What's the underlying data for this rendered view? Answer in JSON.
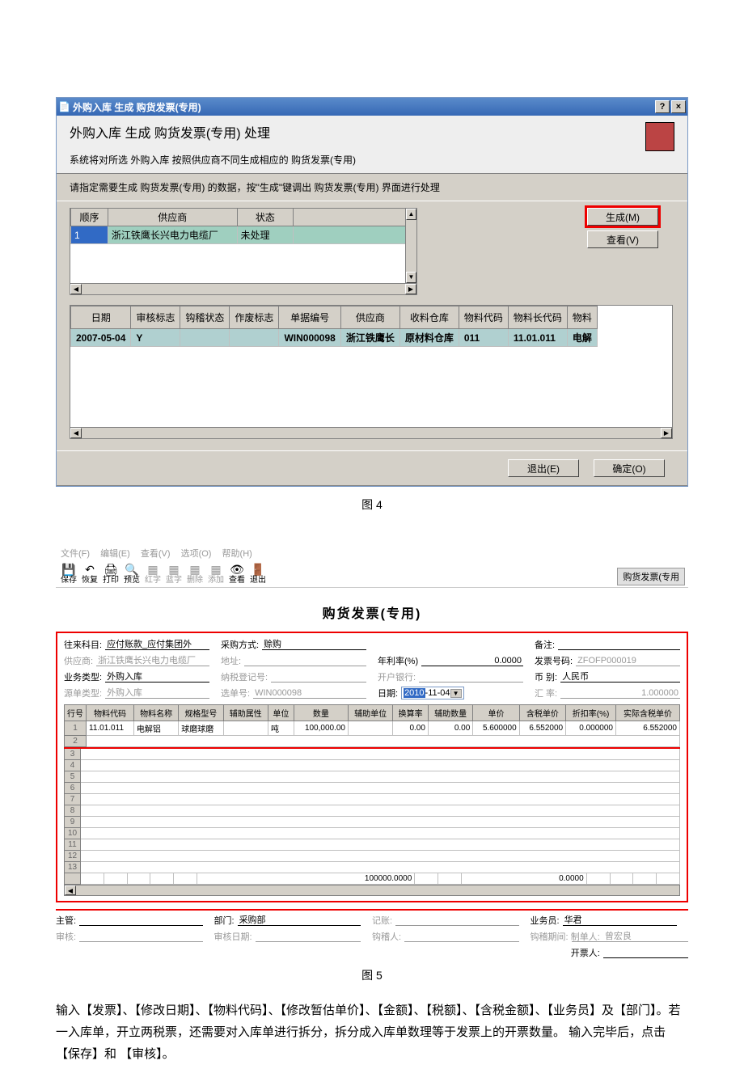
{
  "dialog1": {
    "title": "外购入库 生成 购货发票(专用)",
    "heading": "外购入库 生成 购货发票(专用) 处理",
    "subheading": "系统将对所选 外购入库 按照供应商不同生成相应的 购货发票(专用)",
    "instruction": "请指定需要生成 购货发票(专用) 的数据，按\"生成\"键调出 购货发票(专用) 界面进行处理",
    "help_btn": "?",
    "close_btn": "×",
    "grid1": {
      "cols": {
        "seq": "顺序",
        "supplier": "供应商",
        "status": "状态"
      },
      "row": {
        "seq": "1",
        "supplier": "浙江铁鹰长兴电力电缆厂",
        "status": "未处理"
      }
    },
    "buttons": {
      "generate": "生成(M)",
      "view": "查看(V)",
      "exit": "退出(E)",
      "ok": "确定(O)"
    },
    "grid2": {
      "cols": [
        "日期",
        "审核标志",
        "钩稽状态",
        "作废标志",
        "单据编号",
        "供应商",
        "收料仓库",
        "物料代码",
        "物料长代码",
        "物料"
      ],
      "row": [
        "2007-05-04",
        "Y",
        "",
        "",
        "WIN000098",
        "浙江铁鹰长",
        "原材料仓库",
        "011",
        "11.01.011",
        "电解"
      ]
    }
  },
  "figure4": "图 4",
  "form2": {
    "menu": [
      "文件(F)",
      "编辑(E)",
      "查看(V)",
      "选项(O)",
      "帮助(H)"
    ],
    "toolbar": [
      {
        "icon": "💾",
        "label": "保存"
      },
      {
        "icon": "↶",
        "label": "恢复"
      },
      {
        "icon": "🖨",
        "label": "打印"
      },
      {
        "icon": "🔍",
        "label": "预览"
      },
      {
        "icon": "▦",
        "label": "红字",
        "gray": true
      },
      {
        "icon": "▦",
        "label": "蓝字",
        "gray": true
      },
      {
        "icon": "▦",
        "label": "删除",
        "gray": true
      },
      {
        "icon": "▦",
        "label": "添加",
        "gray": true
      },
      {
        "icon": "👁",
        "label": "查看"
      },
      {
        "icon": "🚪",
        "label": "退出"
      }
    ],
    "badge": "购货发票(专用",
    "title": "购货发票(专用)",
    "fields": {
      "f1l": "往来科目:",
      "f1v": "应付账款_应付集团外",
      "f2l": "采购方式:",
      "f2v": "赊购",
      "f3l": "备注:",
      "f3v": "",
      "f4l": "供应商:",
      "f4v": "浙江铁鹰长兴电力电缆厂",
      "f5l": "地址:",
      "f5v": "",
      "f6l": "年利率(%)",
      "f6v": "0.0000",
      "f7l": "发票号码:",
      "f7v": "ZFOFP000019",
      "f8l": "业务类型:",
      "f8v": "外购入库",
      "f9l": "纳税登记号:",
      "f9v": "",
      "f10l": "开户银行:",
      "f10v": "",
      "f11l": "币    别:",
      "f11v": "人民币",
      "f12l": "源单类型:",
      "f12v": "外购入库",
      "f13l": "选单号:",
      "f13v": "WIN000098",
      "f14l": "日期:",
      "f14y": "2010",
      "f14r": "-11-04",
      "f15l": "汇    率:",
      "f15v": "1.000000"
    },
    "grid": {
      "cols": [
        "行号",
        "物料代码",
        "物料名称",
        "规格型号",
        "辅助属性",
        "单位",
        "数量",
        "辅助单位",
        "换算率",
        "辅助数量",
        "单价",
        "含税单价",
        "折扣率(%)",
        "实际含税单价"
      ],
      "row1": [
        "1",
        "11.01.011",
        "电解铝",
        "球磨球磨",
        "",
        "吨",
        "100,000.00",
        "",
        "0.00",
        "0.00",
        "5.600000",
        "6.552000",
        "0.000000",
        "6.552000"
      ],
      "sum_qty": "100000.0000",
      "sum_aux": "0.0000"
    },
    "bottom": {
      "b1l": "主管:",
      "b1v": "",
      "b2l": "部门:",
      "b2v": "采购部",
      "b3l": "记账:",
      "b3v": "",
      "b4l": "业务员:",
      "b4v": "华君",
      "b5l": "制单人:",
      "b5v": "曾宏良",
      "b6l": "审核:",
      "b6v": "",
      "b7l": "审核日期:",
      "b7v": "",
      "b8l": "钩稽人:",
      "b8v": "",
      "b9l": "钩稽期间:",
      "b9v": "",
      "b10l": "开票人:",
      "b10v": ""
    }
  },
  "figure5": "图 5",
  "bodytext": "输入【发票】、【修改日期】、【物料代码】、【修改暂估单价】、【金额】、【税额】、【含税金额】、【业务员】及【部门】。若一入库单，开立两税票，还需要对入库单进行拆分，拆分成入库单数理等于发票上的开票数量。  输入完毕后，点击【保存】和 【审核】。"
}
